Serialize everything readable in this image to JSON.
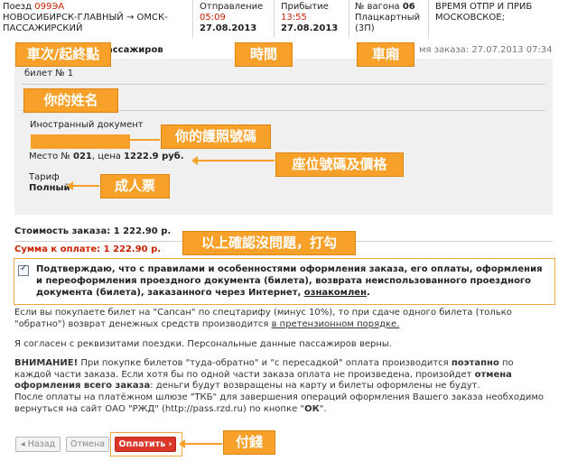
{
  "train": {
    "label": "Поезд",
    "number": "099ЭА",
    "route_line1": "НОВОСИБИРСК-ГЛАВНЫЙ → ОМСК-",
    "route_line2": "ПАССАЖИРСКИЙ"
  },
  "departure": {
    "label": "Отправление",
    "time": "05:09",
    "date": "27.08.2013"
  },
  "arrival": {
    "label": "Прибытие",
    "time": "13:55",
    "date": "27.08.2013"
  },
  "car": {
    "label": "№ вагона",
    "number": "06",
    "type_line1": "Плацкартный",
    "type_line2": "(3П)"
  },
  "time_note": {
    "line1": "ВРЕМЯ ОТПР И ПРИБ",
    "line2": "МОСКОВСКОЕ;"
  },
  "passengers_heading": "ассажиров",
  "order_date": "мя заказа: 27.07.2013 07:34",
  "ticket": {
    "label": "билет № 1",
    "document_label": "Иностранный документ",
    "seat_prefix": "Место №",
    "seat_number": "021",
    "price_prefix": ", цена",
    "price": "1222.9 руб.",
    "tariff_label": "Тариф",
    "tariff_value": "Полный"
  },
  "order_cost": "Стоимость заказа: 1 222.90 р.",
  "amount_due": "Сумма к оплате: 1 222.90 р.",
  "confirm_text_main": "Подтверждаю, что с правилами и особенностями оформления заказа, его оплаты, оформления и переоформления проездного документа (билета), возврата неиспользованного проездного документа (билета), заказанного через Интернет, ",
  "confirm_link": "ознакомлен",
  "confirm_end": ".",
  "sapsan_text": "Если вы покупаете билет на \"Сапсан\" по спецтарифу (минус 10%), то при сдаче одного билета (только \"обратно\") возврат денежных средств производится ",
  "sapsan_link": "в претензионном порядке.",
  "agree_text": "Я согласен с реквизитами поездки. Персональные данные пассажиров верны.",
  "warning_label": "ВНИМАНИЕ!",
  "warning_text1": " При покупке билетов \"туда-обратно\" и \"с пересадкой\" оплата производится ",
  "warning_bold1": "поэтапно",
  "warning_text2": " по каждой части заказа. Если хотя бы по одной части заказа оплата не произведена, произойдет ",
  "warning_bold2": "отмена оформления всего заказа",
  "warning_text3": ": деньги будут возвращены на карту и билеты оформлены не будут.",
  "after_text1": "После оплаты на платёжном шлюзе \"ТКБ\" для завершения операций оформления Вашего заказа необходимо вернуться на сайт ОАО \"РЖД\" (http://pass.rzd.ru) по кнопке \"",
  "after_bold": "ОК",
  "after_text2": "\".",
  "buttons": {
    "back": "◂ Назад",
    "cancel": "Отмена",
    "pay": "Оплатить ›"
  },
  "callouts": {
    "train_route": "車次/起終點",
    "time": "時間",
    "car": "車廂",
    "name": "你的姓名",
    "passport": "你的護照號碼",
    "seat_price": "座位號碼及價格",
    "adult": "成人票",
    "confirm": "以上確認沒問題，打勾",
    "pay": "付錢"
  },
  "colors": {
    "accent_orange": "#f7a12b",
    "price_red": "#cc2200",
    "pay_button": "#d9372a"
  }
}
